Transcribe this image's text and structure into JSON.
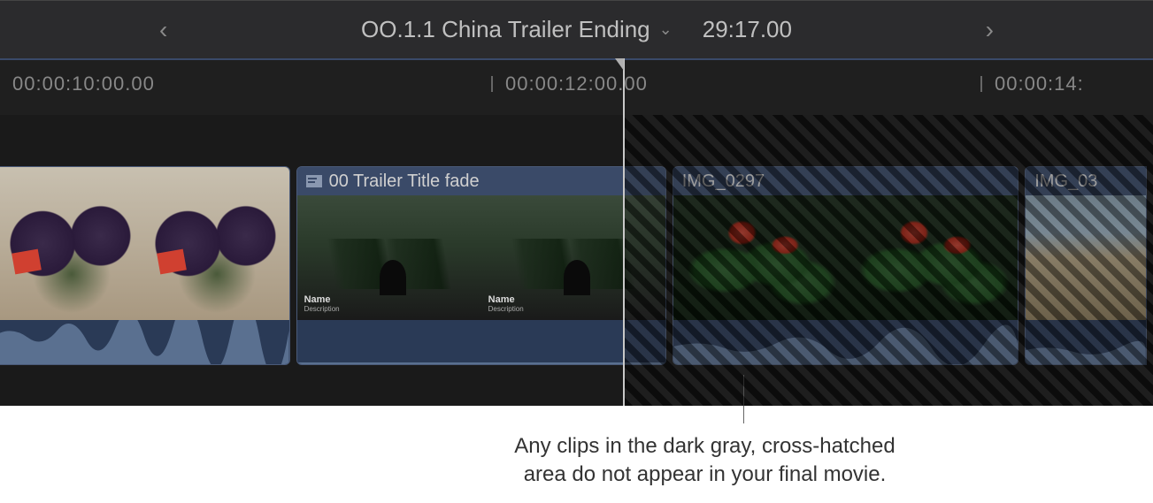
{
  "header": {
    "prev_glyph": "‹",
    "next_glyph": "›",
    "project_title": "OO.1.1 China Trailer Ending",
    "timecode": "29:17.00"
  },
  "ruler": {
    "ticks": [
      {
        "pos": 0,
        "label": "00:00:10:00.00"
      },
      {
        "pos": 555,
        "label": "00:00:12:00.00"
      },
      {
        "pos": 1108,
        "label": "00:00:14:"
      }
    ]
  },
  "clips": [
    {
      "id": "clip1",
      "label": "",
      "type": "video"
    },
    {
      "id": "clip2",
      "label": "00 Trailer Title fade",
      "type": "title",
      "overlay_title": "Name",
      "overlay_sub": "Description"
    },
    {
      "id": "clip3",
      "label": "IMG_0297",
      "type": "video"
    },
    {
      "id": "clip4",
      "label": "IMG_03",
      "type": "video"
    }
  ],
  "annotation": {
    "line1": "Any clips in the dark gray, cross-hatched",
    "line2": "area do not appear in your final movie."
  }
}
